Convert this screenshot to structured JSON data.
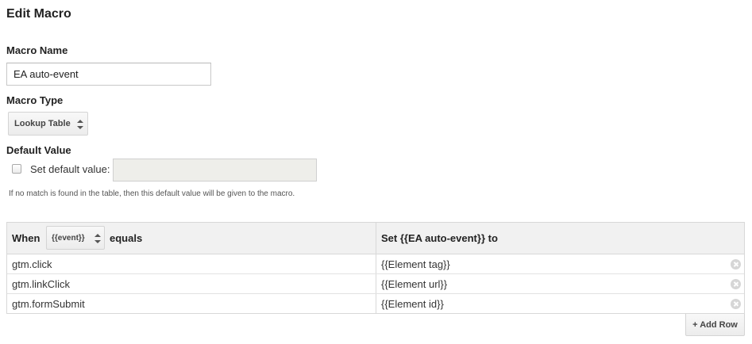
{
  "page": {
    "title": "Edit Macro"
  },
  "macro_name": {
    "label": "Macro Name",
    "value": "EA auto-event"
  },
  "macro_type": {
    "label": "Macro Type",
    "selected": "Lookup Table"
  },
  "default_value": {
    "label": "Default Value",
    "checkbox_label": "Set default value:",
    "checked": false,
    "value": "",
    "hint": "If no match is found in the table, then this default value will be given to the macro."
  },
  "table": {
    "when_label": "When",
    "variable_selected": "{{event}}",
    "equals_label": "equals",
    "set_label": "Set {{EA auto-event}} to",
    "rows": [
      {
        "when": "gtm.click",
        "set": "{{Element tag}}"
      },
      {
        "when": "gtm.linkClick",
        "set": "{{Element url}}"
      },
      {
        "when": "gtm.formSubmit",
        "set": "{{Element id}}"
      }
    ],
    "add_row_label": "+ Add Row"
  },
  "icons": {
    "remove": "close-circle-icon",
    "select_arrows": "up-down-arrows-icon"
  }
}
